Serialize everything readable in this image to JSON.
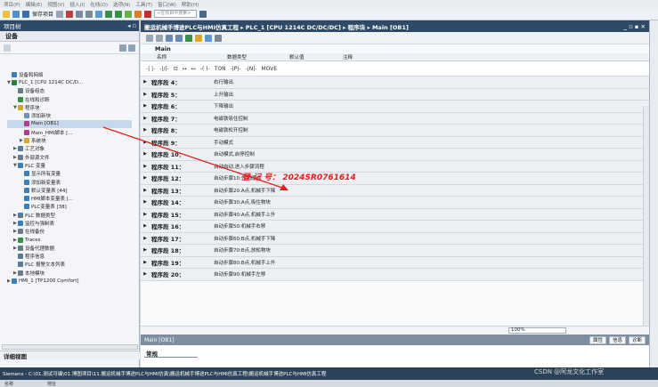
{
  "menu": [
    "项目(P)",
    "编辑(E)",
    "视图(V)",
    "插入(I)",
    "在线(O)",
    "选项(N)",
    "工具(T)",
    "窗口(W)",
    "帮助(H)"
  ],
  "toolbar": {
    "save_label": "保存项目",
    "search_placeholder": "<在项目中搜索>"
  },
  "left_panel": {
    "title": "项目树",
    "tab": "设备",
    "detail_title": "详细视图",
    "name_col": "名称",
    "addr_col": "地址",
    "tree": [
      {
        "label": "设备和网络",
        "level": 1,
        "expand": "",
        "color": "#3c7fb8"
      },
      {
        "label": "PLC_1 [CPU 1214C DC/D...",
        "level": 1,
        "expand": "▼",
        "color": "#2f7d3a"
      },
      {
        "label": "设备组态",
        "level": 2,
        "expand": "",
        "color": "#6a7c8c"
      },
      {
        "label": "在线和诊断",
        "level": 2,
        "expand": "",
        "color": "#3a8f4a"
      },
      {
        "label": "程序块",
        "level": 2,
        "expand": "▼",
        "color": "#d9a72b"
      },
      {
        "label": "添加新块",
        "level": 3,
        "expand": "",
        "color": "#6b8fc4"
      },
      {
        "label": "Main [OB1]",
        "level": 3,
        "expand": "",
        "color": "#b23a8f",
        "selected": true
      },
      {
        "label": "Main_HMI脚本 [...",
        "level": 3,
        "expand": "",
        "color": "#b23a8f"
      },
      {
        "label": "系统块",
        "level": 3,
        "expand": "▶",
        "color": "#d9a72b"
      },
      {
        "label": "工艺对象",
        "level": 2,
        "expand": "▶",
        "color": "#5a7a9a"
      },
      {
        "label": "外部源文件",
        "level": 2,
        "expand": "▶",
        "color": "#6a7c8c"
      },
      {
        "label": "PLC 变量",
        "level": 2,
        "expand": "▼",
        "color": "#3c7fb8"
      },
      {
        "label": "显示所有变量",
        "level": 3,
        "expand": "",
        "color": "#3c7fb8"
      },
      {
        "label": "添加新变量表",
        "level": 3,
        "expand": "",
        "color": "#3c7fb8"
      },
      {
        "label": "默认变量表 [44]",
        "level": 3,
        "expand": "",
        "color": "#3c7fb8"
      },
      {
        "label": "HMI脚本变量表 [...",
        "level": 3,
        "expand": "",
        "color": "#3c7fb8"
      },
      {
        "label": "PLC变量表 [38]",
        "level": 3,
        "expand": "",
        "color": "#3c7fb8"
      },
      {
        "label": "PLC 数据类型",
        "level": 2,
        "expand": "▶",
        "color": "#5a7a9a"
      },
      {
        "label": "监控与强制表",
        "level": 2,
        "expand": "▶",
        "color": "#3c7fb8"
      },
      {
        "label": "在线备份",
        "level": 2,
        "expand": "▶",
        "color": "#6a7c8c"
      },
      {
        "label": "Traces",
        "level": 2,
        "expand": "▶",
        "color": "#3a8f4a"
      },
      {
        "label": "设备代理数据",
        "level": 2,
        "expand": "▶",
        "color": "#6a7c8c"
      },
      {
        "label": "程序信息",
        "level": 2,
        "expand": "",
        "color": "#5a7a9a"
      },
      {
        "label": "PLC 报警文本列表",
        "level": 2,
        "expand": "",
        "color": "#5a7a9a"
      },
      {
        "label": "本地模块",
        "level": 2,
        "expand": "▶",
        "color": "#6a7c8c"
      },
      {
        "label": "HMI_1 [TP1200 Comfort]",
        "level": 1,
        "expand": "▶",
        "color": "#3c7fb8"
      }
    ]
  },
  "main": {
    "breadcrumb": "搬运机械手博途PLC与HMI仿真工程 ▸ PLC_1 [CPU 1214C DC/DC/DC] ▸ 程序块 ▸ Main [OB1]",
    "block_name": "Main",
    "iface_cols": [
      "名称",
      "数据类型",
      "默认值",
      "注释"
    ],
    "networks": [
      {
        "label": "程序段 4：",
        "comment": "右行输出"
      },
      {
        "label": "程序段 5：",
        "comment": "上升输出"
      },
      {
        "label": "程序段 6：",
        "comment": "下降输出"
      },
      {
        "label": "程序段 7：",
        "comment": "电磁铁吸住控制"
      },
      {
        "label": "程序段 8：",
        "comment": "电磁铁松开控制"
      },
      {
        "label": "程序段 9：",
        "comment": "手动模式"
      },
      {
        "label": "程序段 10：",
        "comment": "自动模式,启停控制"
      },
      {
        "label": "程序段 11：",
        "comment": "自动启动,进入步骤流程"
      },
      {
        "label": "程序段 12：",
        "comment": "自动步骤10:先回原点"
      },
      {
        "label": "程序段 13：",
        "comment": "自动步骤20:A点,机械手下降"
      },
      {
        "label": "程序段 14：",
        "comment": "自动步骤30:A点,吸住物块"
      },
      {
        "label": "程序段 15：",
        "comment": "自动步骤40:A点,机械手上升"
      },
      {
        "label": "程序段 16：",
        "comment": "自动步骤50:机械手右移"
      },
      {
        "label": "程序段 17：",
        "comment": "自动步骤60:B点,机械手下降"
      },
      {
        "label": "程序段 18：",
        "comment": "自动步骤70:B点,放松物块"
      },
      {
        "label": "程序段 19：",
        "comment": "自动步骤80:B点,机械手上升"
      },
      {
        "label": "程序段 20：",
        "comment": "自动步骤90:机械手左移"
      }
    ],
    "registration_note": "登 记 号： 2024SR0761614",
    "zoom": "100%",
    "props": {
      "title": "Main [OB1]",
      "tab_props": "属性",
      "tab_info": "信息",
      "tab_diag": "诊断",
      "general": "常规"
    }
  },
  "taskbar": {
    "start": "Siemens - C:\\01.测试可编\\01.博图项目\\11.搬运机械手博途PLC与HMI仿真\\搬运机械手博途PLC与HMI仿真工程\\搬运机械手博途PLC与HMI仿真工程"
  },
  "watermark": "CSDN @阿龙文化工作室"
}
